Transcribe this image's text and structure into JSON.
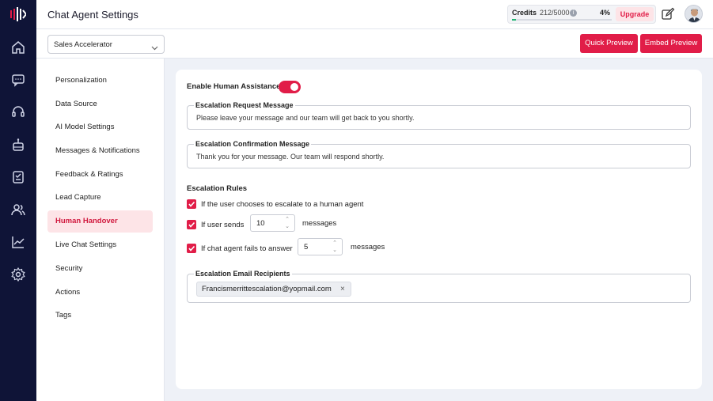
{
  "header": {
    "title": "Chat Agent Settings",
    "credits": {
      "label": "Credits",
      "value": "212/5000",
      "percent": "4%",
      "progress_fraction": 0.04
    },
    "upgrade_label": "Upgrade"
  },
  "nav_icons": [
    "home-icon",
    "chat-icon",
    "headset-icon",
    "bot-icon",
    "inbox-icon",
    "users-icon",
    "analytics-icon",
    "settings-icon"
  ],
  "toolbar": {
    "agent_select": "Sales Accelerator",
    "quick_preview": "Quick Preview",
    "embed_preview": "Embed Preview"
  },
  "menu": {
    "items": [
      "Personalization",
      "Data Source",
      "AI Model Settings",
      "Messages & Notifications",
      "Feedback & Ratings",
      "Lead Capture",
      "Human Handover",
      "Live Chat Settings",
      "Security",
      "Actions",
      "Tags"
    ],
    "active": "Human Handover"
  },
  "form": {
    "enable_label": "Enable Human Assistance",
    "enabled": true,
    "request_label": "Escalation Request Message",
    "request_value": "Please leave your message and our team will get back to you shortly.",
    "confirm_label": "Escalation Confirmation Message",
    "confirm_value": "Thank you for your message. Our team will respond shortly.",
    "rules_title": "Escalation Rules",
    "rule1": "If the user chooses to escalate to a human agent",
    "rule2_prefix": "If user sends",
    "rule2_value": "10",
    "rule2_suffix": "messages",
    "rule3_prefix": "If chat agent fails to answer",
    "rule3_value": "5",
    "rule3_suffix": "messages",
    "email_label": "Escalation Email Recipients",
    "email_chip": "Francismerrittescalation@yopmail.com"
  },
  "colors": {
    "accent": "#e11d48",
    "rail": "#0f1437",
    "success": "#22b573"
  }
}
